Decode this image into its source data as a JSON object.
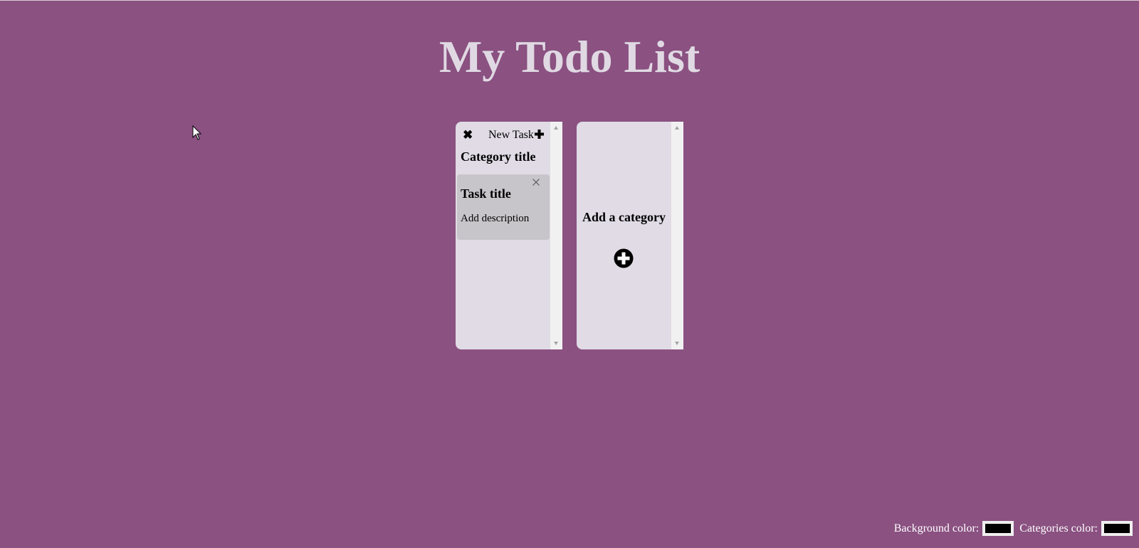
{
  "page": {
    "title": "My Todo List",
    "background_color": "#8a5181"
  },
  "categories": [
    {
      "delete_icon": "close-icon",
      "new_task_label": "New Task",
      "new_task_icon": "plus-icon",
      "title": "Category title",
      "tasks": [
        {
          "title": "Task title",
          "description": "Add description",
          "delete_icon": "close-icon"
        }
      ]
    }
  ],
  "add_category": {
    "label": "Add a category",
    "icon": "plus-circle-icon"
  },
  "footer": {
    "background_color_label": "Background color:",
    "background_color_value": "#000000",
    "categories_color_label": "Categories color:",
    "categories_color_value": "#000000"
  },
  "colors": {
    "category_background": "#e0dbe5",
    "task_background": "#c8c5ca",
    "title_text": "#e0d9e3"
  }
}
